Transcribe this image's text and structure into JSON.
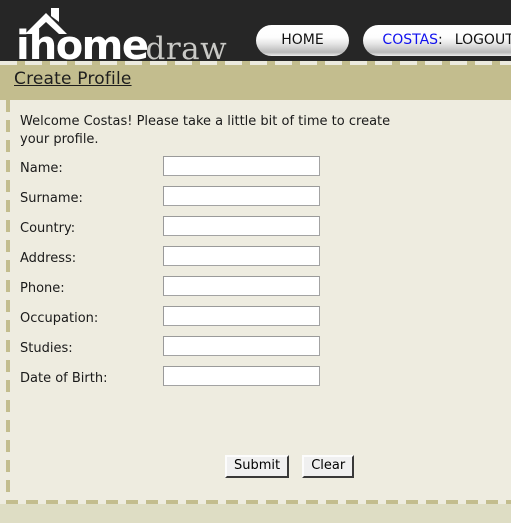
{
  "header": {
    "logo": {
      "part1": "i",
      "part2": "home",
      "part3": "draw",
      "roof_icon": "house-roof-icon"
    },
    "nav": {
      "home_label": "HOME",
      "user_name": "COSTAS",
      "separator": ":",
      "logout_label": "LOGOUT"
    }
  },
  "title_bar": {
    "page_title": "Create Profile"
  },
  "content": {
    "welcome_message": "Welcome Costas! Please take a little bit of time to create your profile.",
    "form": {
      "fields": [
        {
          "label": "Name:",
          "value": "",
          "placeholder": "",
          "name": "name"
        },
        {
          "label": "Surname:",
          "value": "",
          "placeholder": "",
          "name": "surname"
        },
        {
          "label": "Country:",
          "value": "",
          "placeholder": "",
          "name": "country"
        },
        {
          "label": "Address:",
          "value": "",
          "placeholder": "",
          "name": "address"
        },
        {
          "label": "Phone:",
          "value": "",
          "placeholder": "",
          "name": "phone"
        },
        {
          "label": "Occupation:",
          "value": "",
          "placeholder": "",
          "name": "occupation"
        },
        {
          "label": "Studies:",
          "value": "",
          "placeholder": "",
          "name": "studies"
        },
        {
          "label": "Date of Birth:",
          "value": "",
          "placeholder": "",
          "name": "date-of-birth"
        }
      ],
      "submit_label": "Submit",
      "clear_label": "Clear"
    }
  },
  "colors": {
    "header_bg": "#262626",
    "title_bar_bg": "#c3bd8e",
    "content_bg": "#eeece0",
    "page_bg": "#deddc4",
    "link_blue": "#1111ee",
    "dash_tan": "#c3bd8e"
  }
}
